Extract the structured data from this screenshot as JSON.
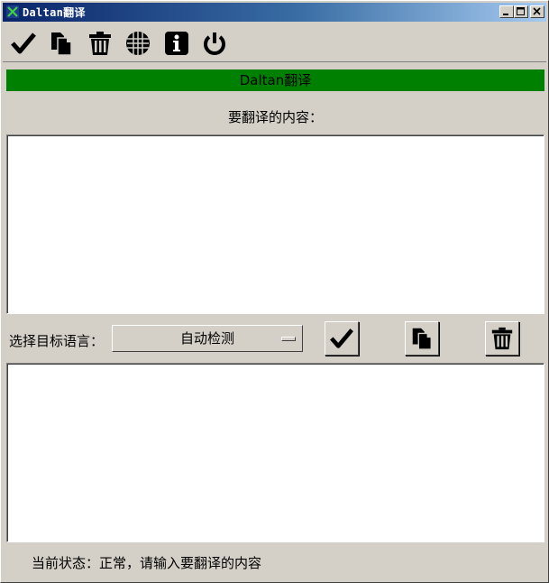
{
  "window": {
    "title": "Daltan翻译",
    "icon": "app-x-icon",
    "controls": [
      "minimize-icon",
      "maximize-icon",
      "close-icon"
    ]
  },
  "toolbar": {
    "icons": [
      "check-icon",
      "copy-icon",
      "trash-icon",
      "globe-icon",
      "info-icon",
      "power-icon"
    ]
  },
  "banner": {
    "text": "Daltan翻译",
    "color": "#008000"
  },
  "source": {
    "label": "要翻译的内容：",
    "value": ""
  },
  "language": {
    "label": "选择目标语言：",
    "selected": "自动检测"
  },
  "actions": {
    "icons": [
      "check-icon",
      "copy-icon",
      "trash-icon"
    ]
  },
  "result": {
    "value": ""
  },
  "status": {
    "text": "当前状态：正常，请输入要翻译的内容"
  }
}
